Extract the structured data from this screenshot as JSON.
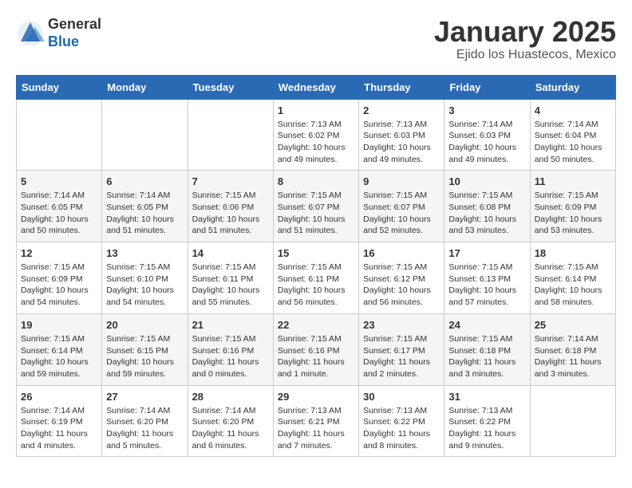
{
  "header": {
    "logo_general": "General",
    "logo_blue": "Blue",
    "title": "January 2025",
    "location": "Ejido los Huastecos, Mexico"
  },
  "weekdays": [
    "Sunday",
    "Monday",
    "Tuesday",
    "Wednesday",
    "Thursday",
    "Friday",
    "Saturday"
  ],
  "weeks": [
    [
      {
        "day": "",
        "info": ""
      },
      {
        "day": "",
        "info": ""
      },
      {
        "day": "",
        "info": ""
      },
      {
        "day": "1",
        "info": "Sunrise: 7:13 AM\nSunset: 6:02 PM\nDaylight: 10 hours\nand 49 minutes."
      },
      {
        "day": "2",
        "info": "Sunrise: 7:13 AM\nSunset: 6:03 PM\nDaylight: 10 hours\nand 49 minutes."
      },
      {
        "day": "3",
        "info": "Sunrise: 7:14 AM\nSunset: 6:03 PM\nDaylight: 10 hours\nand 49 minutes."
      },
      {
        "day": "4",
        "info": "Sunrise: 7:14 AM\nSunset: 6:04 PM\nDaylight: 10 hours\nand 50 minutes."
      }
    ],
    [
      {
        "day": "5",
        "info": "Sunrise: 7:14 AM\nSunset: 6:05 PM\nDaylight: 10 hours\nand 50 minutes."
      },
      {
        "day": "6",
        "info": "Sunrise: 7:14 AM\nSunset: 6:05 PM\nDaylight: 10 hours\nand 51 minutes."
      },
      {
        "day": "7",
        "info": "Sunrise: 7:15 AM\nSunset: 6:06 PM\nDaylight: 10 hours\nand 51 minutes."
      },
      {
        "day": "8",
        "info": "Sunrise: 7:15 AM\nSunset: 6:07 PM\nDaylight: 10 hours\nand 51 minutes."
      },
      {
        "day": "9",
        "info": "Sunrise: 7:15 AM\nSunset: 6:07 PM\nDaylight: 10 hours\nand 52 minutes."
      },
      {
        "day": "10",
        "info": "Sunrise: 7:15 AM\nSunset: 6:08 PM\nDaylight: 10 hours\nand 53 minutes."
      },
      {
        "day": "11",
        "info": "Sunrise: 7:15 AM\nSunset: 6:09 PM\nDaylight: 10 hours\nand 53 minutes."
      }
    ],
    [
      {
        "day": "12",
        "info": "Sunrise: 7:15 AM\nSunset: 6:09 PM\nDaylight: 10 hours\nand 54 minutes."
      },
      {
        "day": "13",
        "info": "Sunrise: 7:15 AM\nSunset: 6:10 PM\nDaylight: 10 hours\nand 54 minutes."
      },
      {
        "day": "14",
        "info": "Sunrise: 7:15 AM\nSunset: 6:11 PM\nDaylight: 10 hours\nand 55 minutes."
      },
      {
        "day": "15",
        "info": "Sunrise: 7:15 AM\nSunset: 6:11 PM\nDaylight: 10 hours\nand 56 minutes."
      },
      {
        "day": "16",
        "info": "Sunrise: 7:15 AM\nSunset: 6:12 PM\nDaylight: 10 hours\nand 56 minutes."
      },
      {
        "day": "17",
        "info": "Sunrise: 7:15 AM\nSunset: 6:13 PM\nDaylight: 10 hours\nand 57 minutes."
      },
      {
        "day": "18",
        "info": "Sunrise: 7:15 AM\nSunset: 6:14 PM\nDaylight: 10 hours\nand 58 minutes."
      }
    ],
    [
      {
        "day": "19",
        "info": "Sunrise: 7:15 AM\nSunset: 6:14 PM\nDaylight: 10 hours\nand 59 minutes."
      },
      {
        "day": "20",
        "info": "Sunrise: 7:15 AM\nSunset: 6:15 PM\nDaylight: 10 hours\nand 59 minutes."
      },
      {
        "day": "21",
        "info": "Sunrise: 7:15 AM\nSunset: 6:16 PM\nDaylight: 11 hours\nand 0 minutes."
      },
      {
        "day": "22",
        "info": "Sunrise: 7:15 AM\nSunset: 6:16 PM\nDaylight: 11 hours\nand 1 minute."
      },
      {
        "day": "23",
        "info": "Sunrise: 7:15 AM\nSunset: 6:17 PM\nDaylight: 11 hours\nand 2 minutes."
      },
      {
        "day": "24",
        "info": "Sunrise: 7:15 AM\nSunset: 6:18 PM\nDaylight: 11 hours\nand 3 minutes."
      },
      {
        "day": "25",
        "info": "Sunrise: 7:14 AM\nSunset: 6:18 PM\nDaylight: 11 hours\nand 3 minutes."
      }
    ],
    [
      {
        "day": "26",
        "info": "Sunrise: 7:14 AM\nSunset: 6:19 PM\nDaylight: 11 hours\nand 4 minutes."
      },
      {
        "day": "27",
        "info": "Sunrise: 7:14 AM\nSunset: 6:20 PM\nDaylight: 11 hours\nand 5 minutes."
      },
      {
        "day": "28",
        "info": "Sunrise: 7:14 AM\nSunset: 6:20 PM\nDaylight: 11 hours\nand 6 minutes."
      },
      {
        "day": "29",
        "info": "Sunrise: 7:13 AM\nSunset: 6:21 PM\nDaylight: 11 hours\nand 7 minutes."
      },
      {
        "day": "30",
        "info": "Sunrise: 7:13 AM\nSunset: 6:22 PM\nDaylight: 11 hours\nand 8 minutes."
      },
      {
        "day": "31",
        "info": "Sunrise: 7:13 AM\nSunset: 6:22 PM\nDaylight: 11 hours\nand 9 minutes."
      },
      {
        "day": "",
        "info": ""
      }
    ]
  ]
}
